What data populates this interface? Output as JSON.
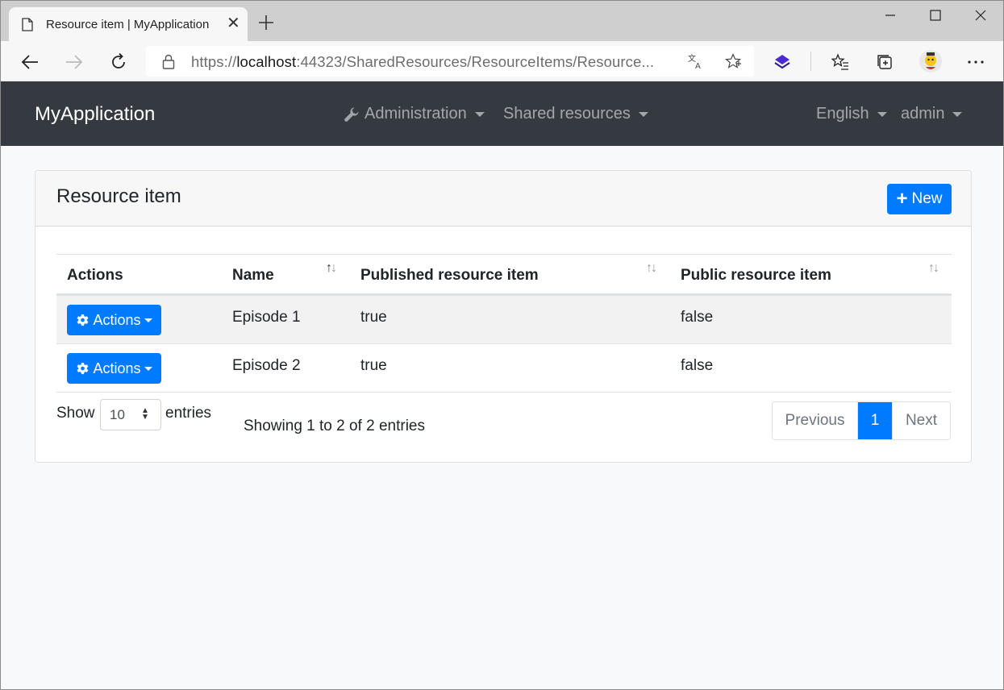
{
  "browser": {
    "tab_title": "Resource item | MyApplication",
    "url_prefix": "https://",
    "url_host": "localhost",
    "url_rest": ":44323/SharedResources/ResourceItems/Resource..."
  },
  "navbar": {
    "brand": "MyApplication",
    "administration": "Administration",
    "shared_resources": "Shared resources",
    "language": "English",
    "user": "admin"
  },
  "card": {
    "title": "Resource item",
    "new_button": "New"
  },
  "table": {
    "columns": [
      "Actions",
      "Name",
      "Published resource item",
      "Public resource item"
    ],
    "rows": [
      {
        "actions": "Actions",
        "name": "Episode 1",
        "published": "true",
        "public": "false"
      },
      {
        "actions": "Actions",
        "name": "Episode 2",
        "published": "true",
        "public": "false"
      }
    ]
  },
  "footer": {
    "show_label": "Show",
    "page_length": "10",
    "entries_label": "entries",
    "info": "Showing 1 to 2 of 2 entries",
    "previous": "Previous",
    "current_page": "1",
    "next": "Next"
  },
  "colors": {
    "primary": "#007bff",
    "navbar": "#343a40"
  }
}
